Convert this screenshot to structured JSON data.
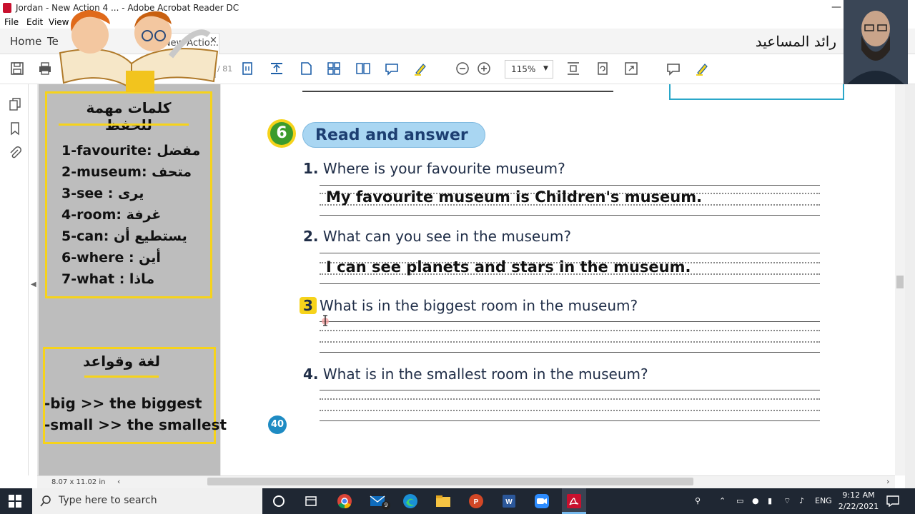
{
  "window": {
    "title": "Jordan - New Action 4 ... - Adobe Acrobat Reader DC",
    "minimize_glyph": "—"
  },
  "menu": {
    "file": "File",
    "edit": "Edit",
    "view": "View"
  },
  "tabs": {
    "home": "Home",
    "tools": "Te",
    "doc": "- New Actio...",
    "close": "×"
  },
  "header": {
    "author_name": "رائد المساعيد"
  },
  "toolbar": {
    "zoom": "115%",
    "page_total": "/ 81"
  },
  "left_panel": {
    "vocab_title": "كلمات مهمة للحفظ",
    "vocab": [
      "1-favourite: مفضل",
      "2-museum: متحف",
      "3-see : يرى",
      "4-room: غرفة",
      "5-can: يستطيع أن",
      "6-where : أين",
      "7-what : ماذا"
    ],
    "grammar_title": "لغة وقواعد",
    "grammar": [
      "-big >> the biggest",
      "-small >> the smallest"
    ]
  },
  "worksheet": {
    "section_number": "6",
    "section_title": "Read and answer",
    "questions": [
      {
        "num": "1.",
        "text": "Where is your favourite museum?",
        "answer": "My favourite museum is Children's museum."
      },
      {
        "num": "2.",
        "text": "What can you see in the museum?",
        "answer": "I can see planets and stars in the museum."
      },
      {
        "num": "3.",
        "text": "What is in the biggest room in the museum?",
        "answer": ""
      },
      {
        "num": "4.",
        "text": "What is in the smallest room in the museum?",
        "answer": ""
      }
    ],
    "page_number": "40"
  },
  "status": {
    "page_size": "8.07 x 11.02 in"
  },
  "taskbar": {
    "search_placeholder": "Type here to search",
    "mail_badge": "9",
    "language": "ENG",
    "time": "9:12 AM",
    "date": "2/22/2021"
  },
  "colors": {
    "highlight_yellow": "#f6d31b",
    "taskbar": "#1f2733",
    "acrobat_red": "#c8102e",
    "section_blue": "#a9d6f2",
    "badge_green": "#3b9b2c"
  }
}
